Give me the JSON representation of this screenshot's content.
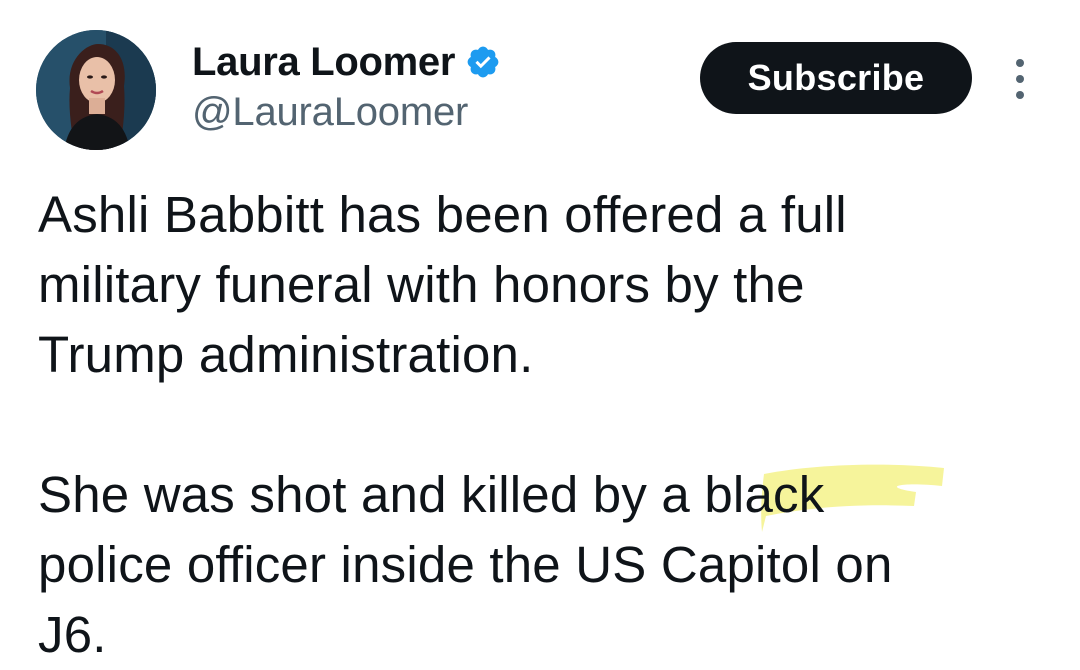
{
  "author": {
    "display_name": "Laura Loomer",
    "handle": "@LauraLoomer",
    "verified_icon": "verified-badge-icon",
    "accent": "#1d9bf0"
  },
  "actions": {
    "subscribe_label": "Subscribe",
    "more_icon": "more-vertical-icon"
  },
  "tweet": {
    "paragraph_1_lines": [
      "Ashli Babbitt has been offered a full",
      "military funeral with honors by the",
      "Trump administration."
    ],
    "paragraph_2_lines": [
      "She was shot and killed by a black",
      "police officer inside the US Capitol on",
      "J6."
    ]
  },
  "colors": {
    "text": "#0f1419",
    "secondary": "#536471",
    "button_bg": "#0f1419",
    "highlight": "#f3f07a"
  }
}
